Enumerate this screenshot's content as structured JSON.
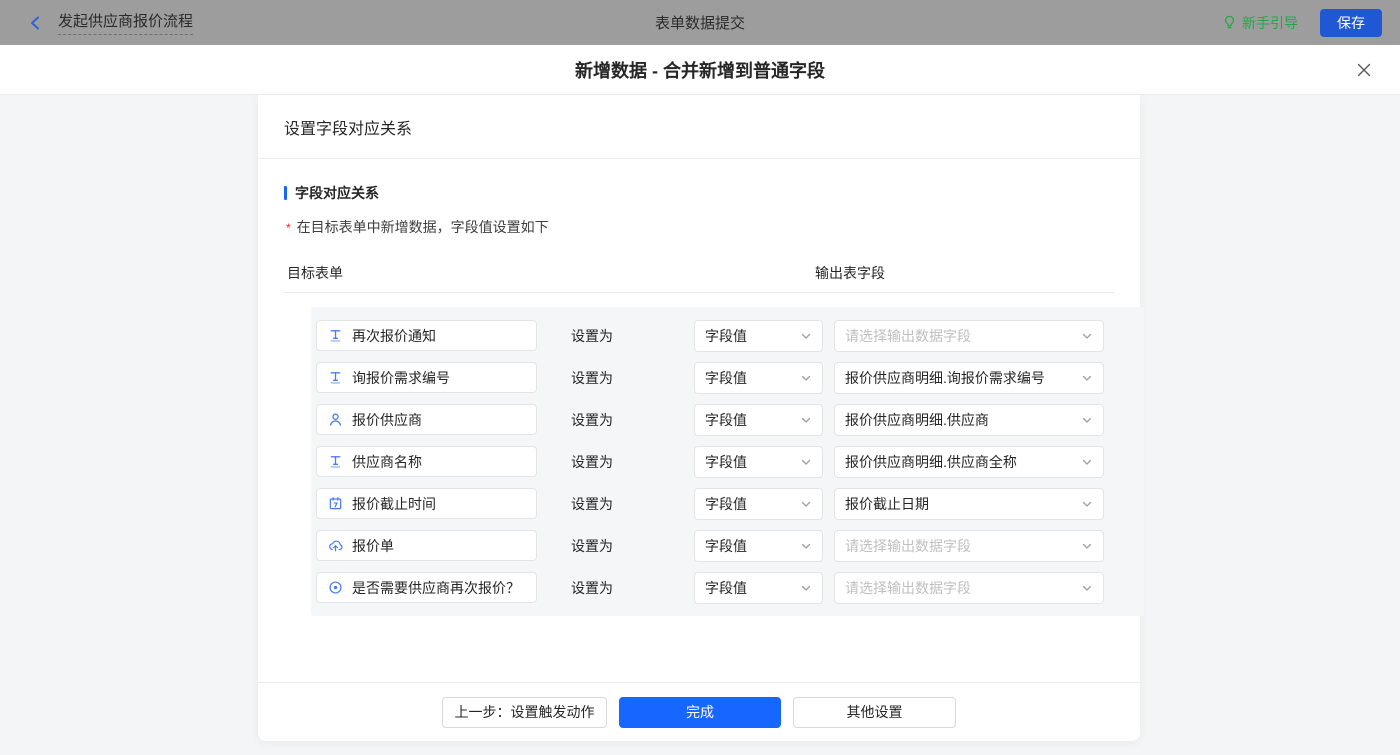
{
  "topbar": {
    "back_label": "发起供应商报价流程",
    "title": "表单数据提交",
    "guide_label": "新手引导",
    "save_label": "保存"
  },
  "modal": {
    "title": "新增数据 - 合并新增到普通字段"
  },
  "panel": {
    "header": "设置字段对应关系",
    "section_title": "字段对应关系",
    "required_mark": "*",
    "hint": "在目标表单中新增数据，字段值设置如下",
    "columns": {
      "target": "目标表单",
      "output": "输出表字段"
    },
    "set_as_label": "设置为"
  },
  "rows": [
    {
      "field": "再次报价通知",
      "icon": "text-field-icon",
      "value_type": "字段值",
      "output": "请选择输出数据字段",
      "output_placeholder": true
    },
    {
      "field": "询报价需求编号",
      "icon": "text-field-icon",
      "value_type": "字段值",
      "output": "报价供应商明细.询报价需求编号",
      "output_placeholder": false
    },
    {
      "field": "报价供应商",
      "icon": "person-icon",
      "value_type": "字段值",
      "output": "报价供应商明细.供应商",
      "output_placeholder": false
    },
    {
      "field": "供应商名称",
      "icon": "text-field-icon",
      "value_type": "字段值",
      "output": "报价供应商明细.供应商全称",
      "output_placeholder": false
    },
    {
      "field": "报价截止时间",
      "icon": "calendar-icon",
      "value_type": "字段值",
      "output": "报价截止日期",
      "output_placeholder": false
    },
    {
      "field": "报价单",
      "icon": "upload-cloud-icon",
      "value_type": "字段值",
      "output": "请选择输出数据字段",
      "output_placeholder": true
    },
    {
      "field": "是否需要供应商再次报价？",
      "icon": "radio-icon",
      "value_type": "字段值",
      "output": "请选择输出数据字段",
      "output_placeholder": true
    }
  ],
  "footer": {
    "prev_label": "上一步：设置触发动作",
    "done_label": "完成",
    "other_label": "其他设置"
  },
  "colors": {
    "topbar_gray": "#9d9d9d",
    "accent_blue": "#1666ff",
    "save_blue": "#2057d2",
    "guide_green": "#27a742",
    "icon_blue": "#4a7bf5",
    "required_red": "#f5222d",
    "placeholder_gray": "#bfbfbf"
  }
}
